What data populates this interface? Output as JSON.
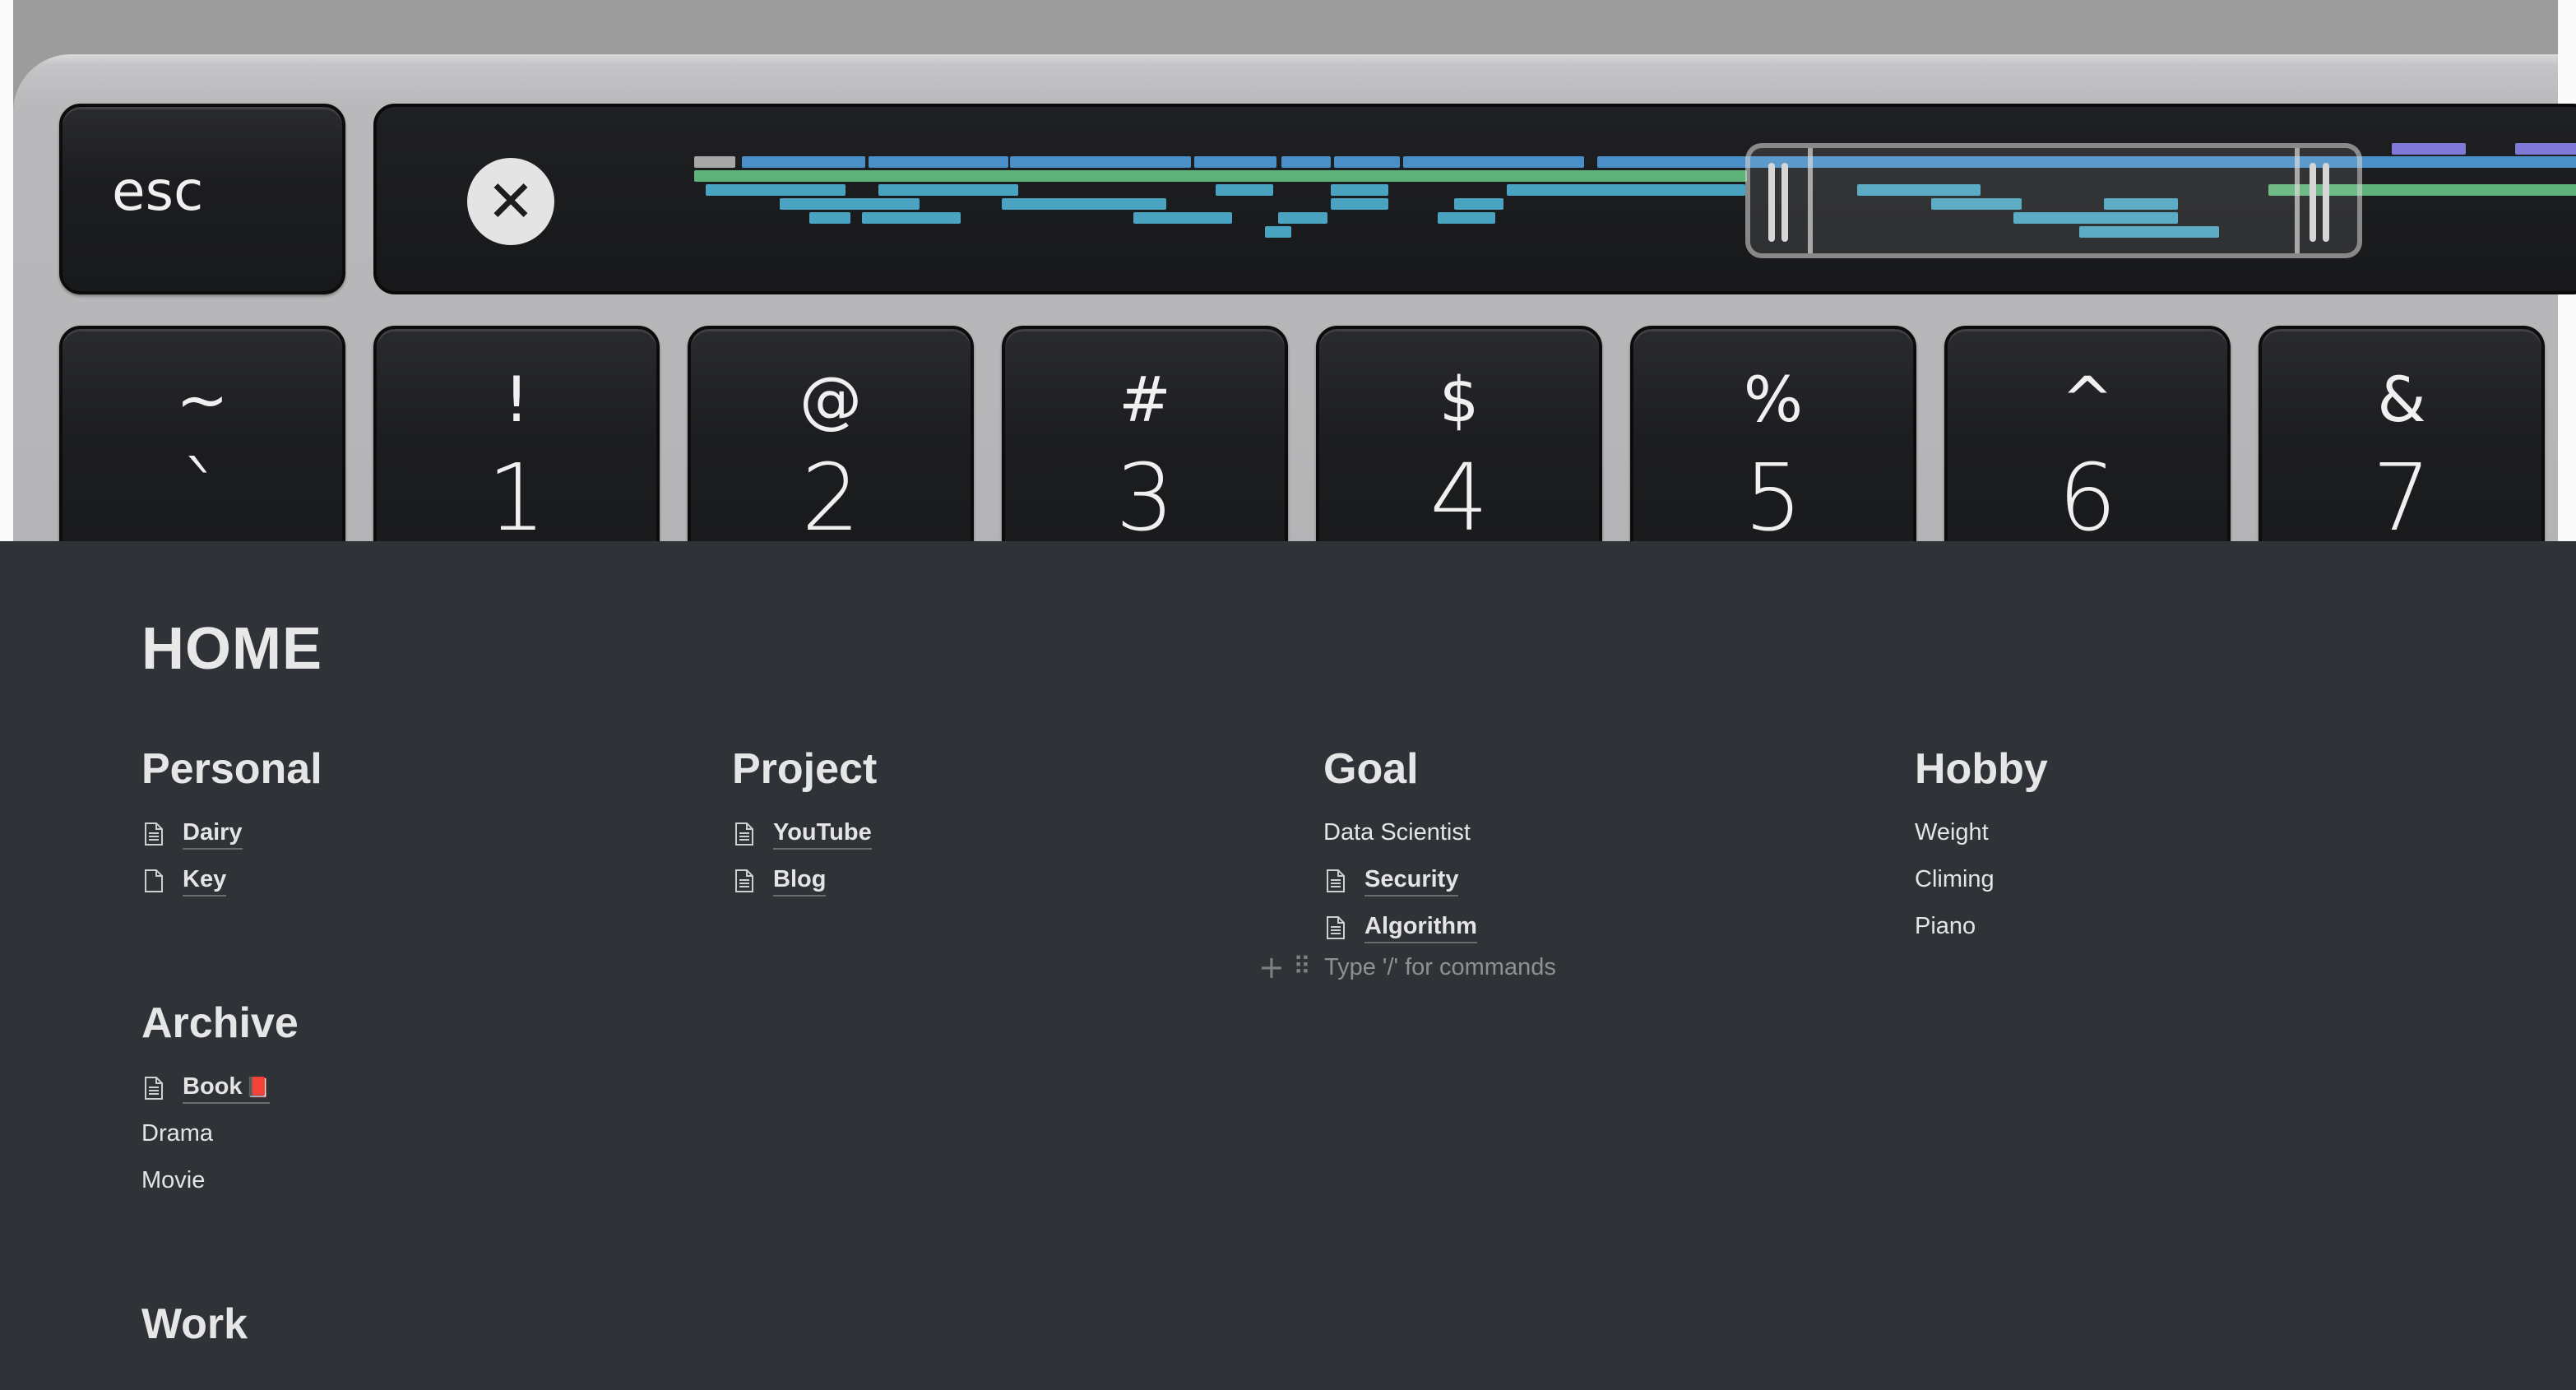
{
  "cover": {
    "escape_key": "esc",
    "number_keys": [
      {
        "shift": "~",
        "main": "`"
      },
      {
        "shift": "!",
        "main": "1"
      },
      {
        "shift": "@",
        "main": "2"
      },
      {
        "shift": "#",
        "main": "3"
      },
      {
        "shift": "$",
        "main": "4"
      },
      {
        "shift": "%",
        "main": "5"
      },
      {
        "shift": "^",
        "main": "6"
      },
      {
        "shift": "&",
        "main": "7"
      }
    ],
    "close_icon": "close-icon",
    "colors": {
      "blue": "#4a8fc7",
      "teal": "#4aa3c0",
      "green": "#5fb37a",
      "purple": "#8079d8",
      "gray": "#a7a7a7"
    }
  },
  "page": {
    "title": "HOME",
    "sections": {
      "personal": {
        "heading": "Personal",
        "items": [
          "Dairy",
          "Key"
        ]
      },
      "project": {
        "heading": "Project",
        "items": [
          "YouTube",
          "Blog"
        ]
      },
      "goal": {
        "heading": "Goal",
        "items": [
          "Data Scientist",
          "Security",
          "Algorithm"
        ]
      },
      "hobby": {
        "heading": "Hobby",
        "items": [
          "Weight",
          "Climing",
          "Piano"
        ]
      },
      "archive": {
        "heading": "Archive",
        "items": [
          "Book",
          "Drama",
          "Movie"
        ],
        "book_emoji": "📕"
      },
      "work": {
        "heading": "Work"
      }
    },
    "block_placeholder": "Type '/' for commands",
    "icons": {
      "page": "document-icon",
      "add": "plus-icon",
      "drag": "drag-handle-icon"
    }
  }
}
